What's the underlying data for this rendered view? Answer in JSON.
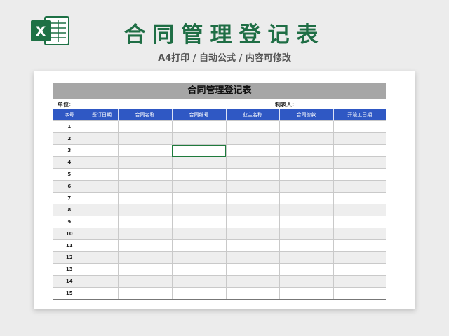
{
  "header": {
    "title": "合同管理登记表",
    "subtitle": "A4打印 / 自动公式 / 内容可修改",
    "icon": "excel-icon",
    "accent_color": "#1f6e45"
  },
  "sheet": {
    "title": "合同管理登记表",
    "unit_label": "单位:",
    "maker_label": "制表人:",
    "header_color": "#2f58c4",
    "columns": [
      "序号",
      "签订日期",
      "合同名称",
      "合同编号",
      "业主名称",
      "合同价款",
      "开竣工日期"
    ],
    "rows": [
      "1",
      "2",
      "3",
      "4",
      "5",
      "6",
      "7",
      "8",
      "9",
      "10",
      "11",
      "12",
      "13",
      "14",
      "15"
    ],
    "selected_cell": {
      "row": "3",
      "column": "合同编号"
    }
  }
}
